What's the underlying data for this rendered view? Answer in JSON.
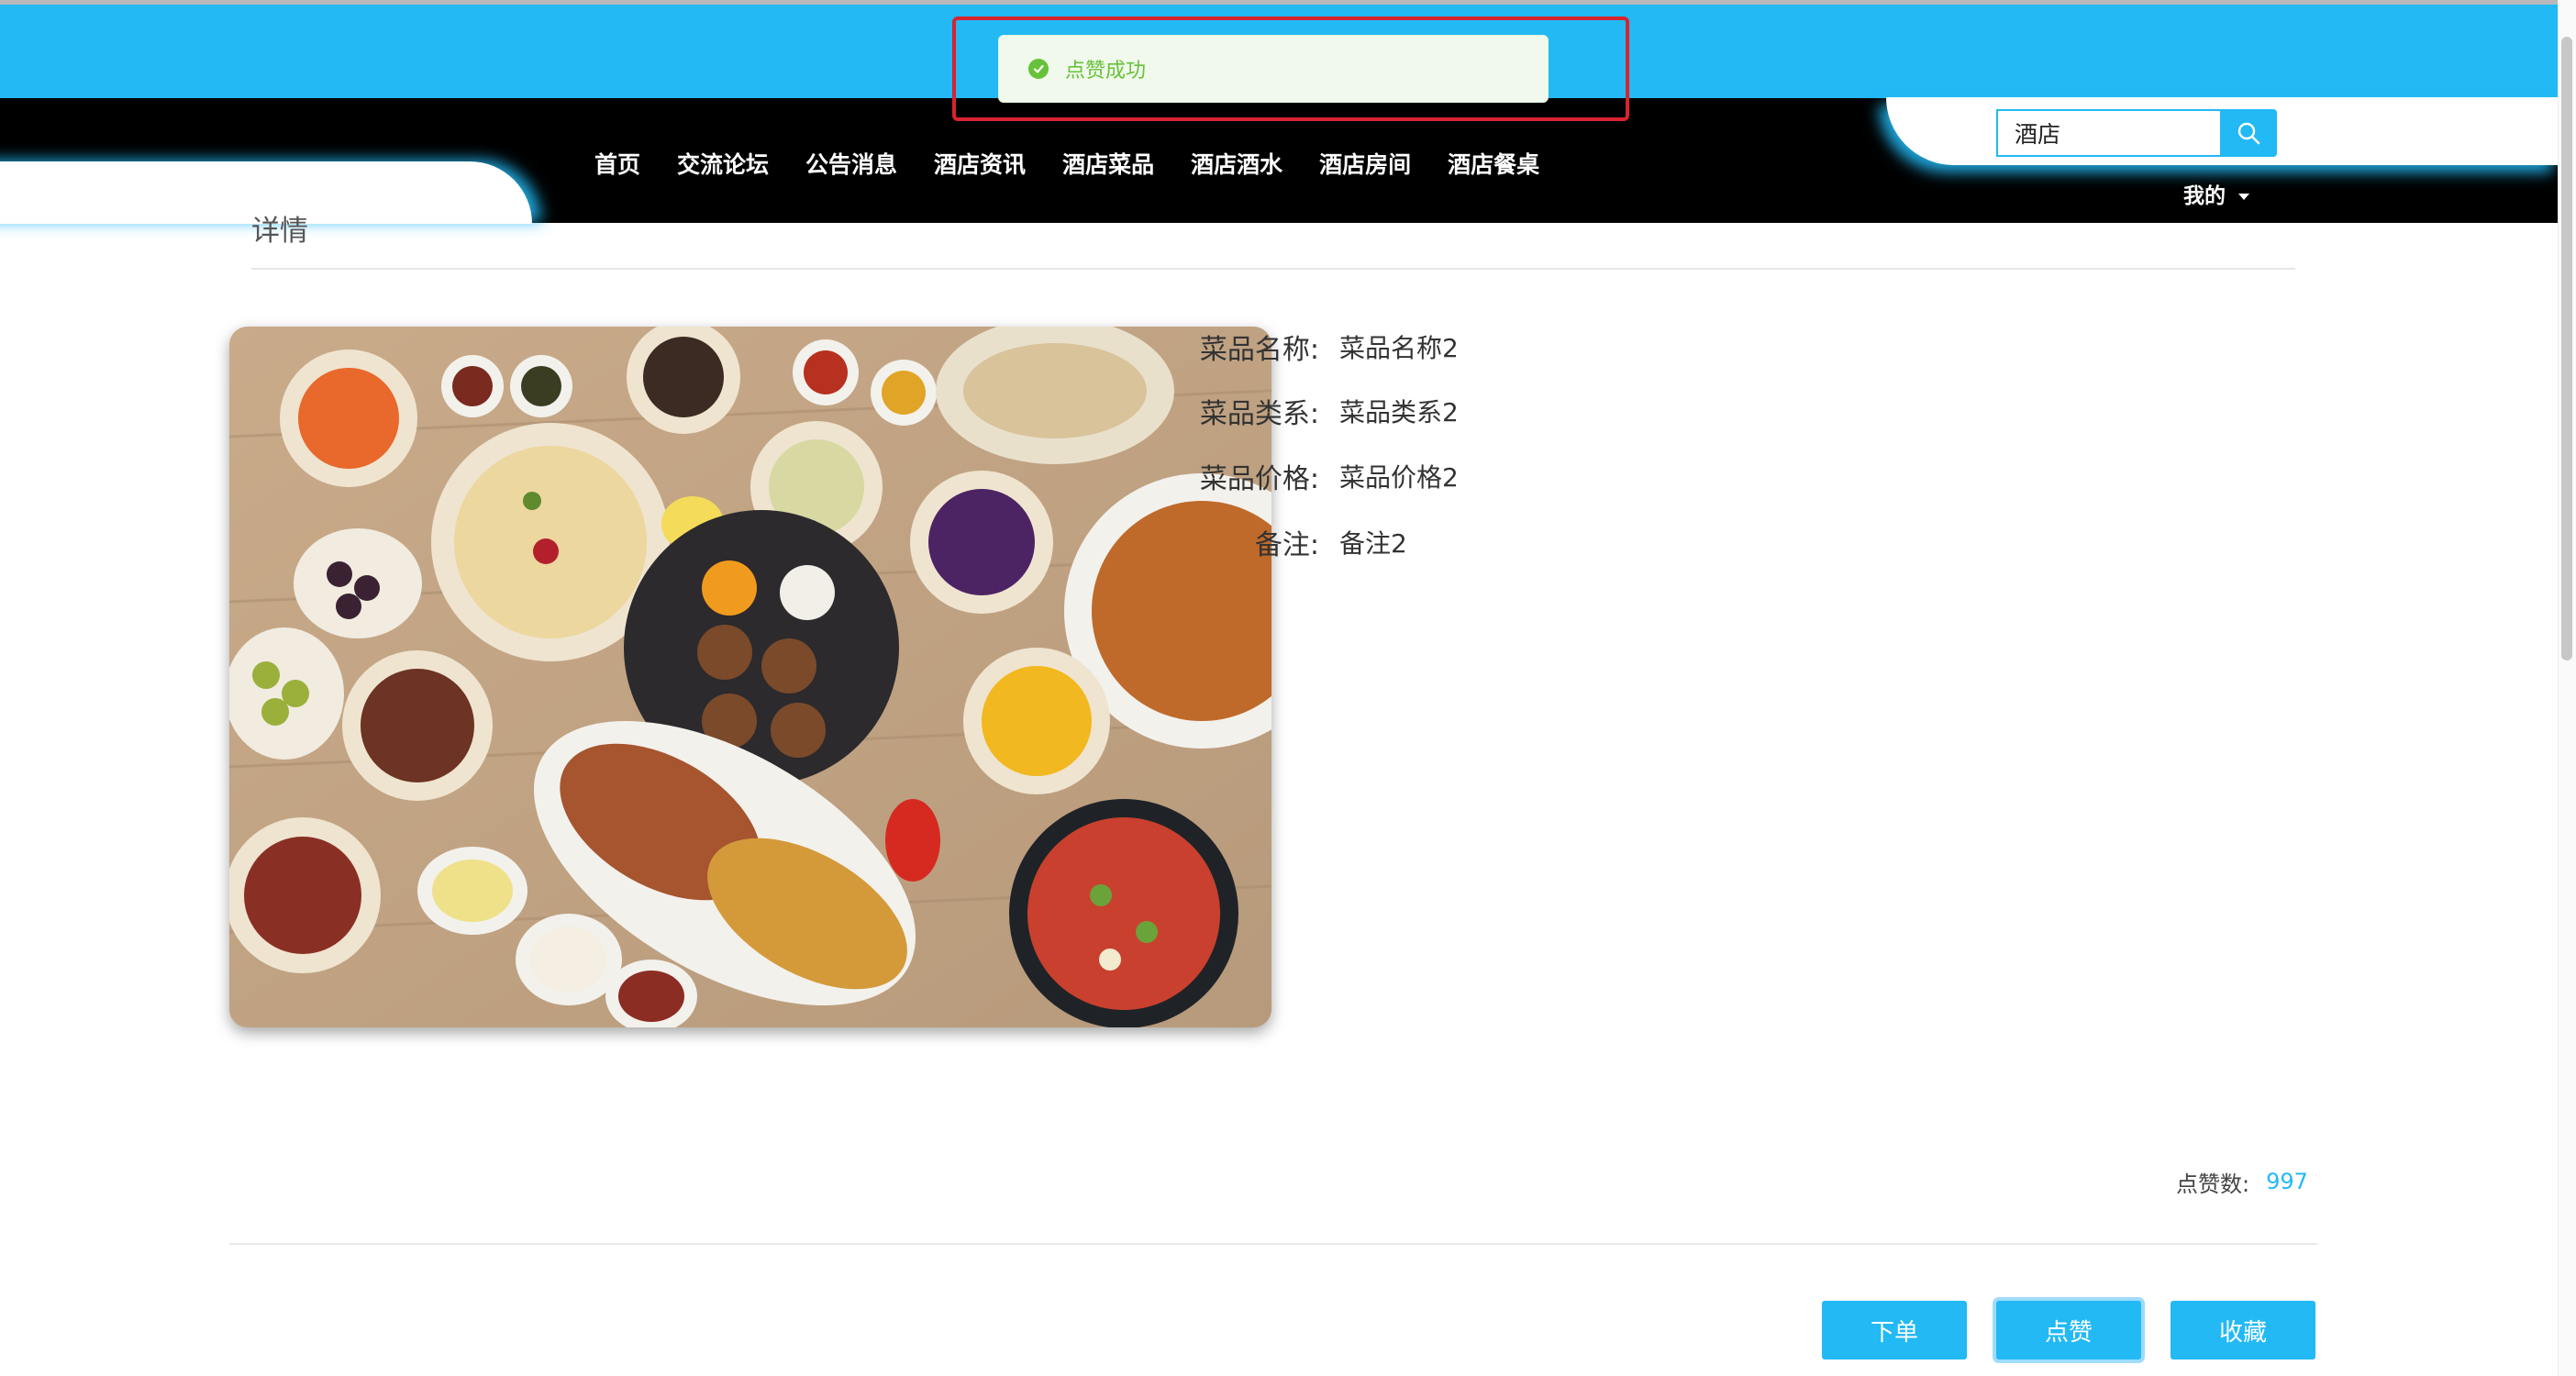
{
  "toast": {
    "message": "点赞成功",
    "icon": "check-circle-icon",
    "color": "#67c23a"
  },
  "header": {
    "accent_color": "#22b9f5",
    "search": {
      "value": "酒店",
      "icon": "search-icon"
    },
    "nav": [
      "首页",
      "交流论坛",
      "公告消息",
      "酒店资讯",
      "酒店菜品",
      "酒店酒水",
      "酒店房间",
      "酒店餐桌"
    ],
    "user_menu": "我的"
  },
  "page": {
    "title": "详情",
    "image": {
      "subject": "food-spread-photo"
    },
    "fields": [
      {
        "label": "菜品名称:",
        "value": "菜品名称2"
      },
      {
        "label": "菜品类系:",
        "value": "菜品类系2"
      },
      {
        "label": "菜品价格:",
        "value": "菜品价格2"
      },
      {
        "label": "备注:",
        "value": "备注2"
      }
    ],
    "likes": {
      "label": "点赞数:",
      "value": "997"
    },
    "actions": {
      "order": "下单",
      "like": "点赞",
      "favorite": "收藏"
    }
  }
}
